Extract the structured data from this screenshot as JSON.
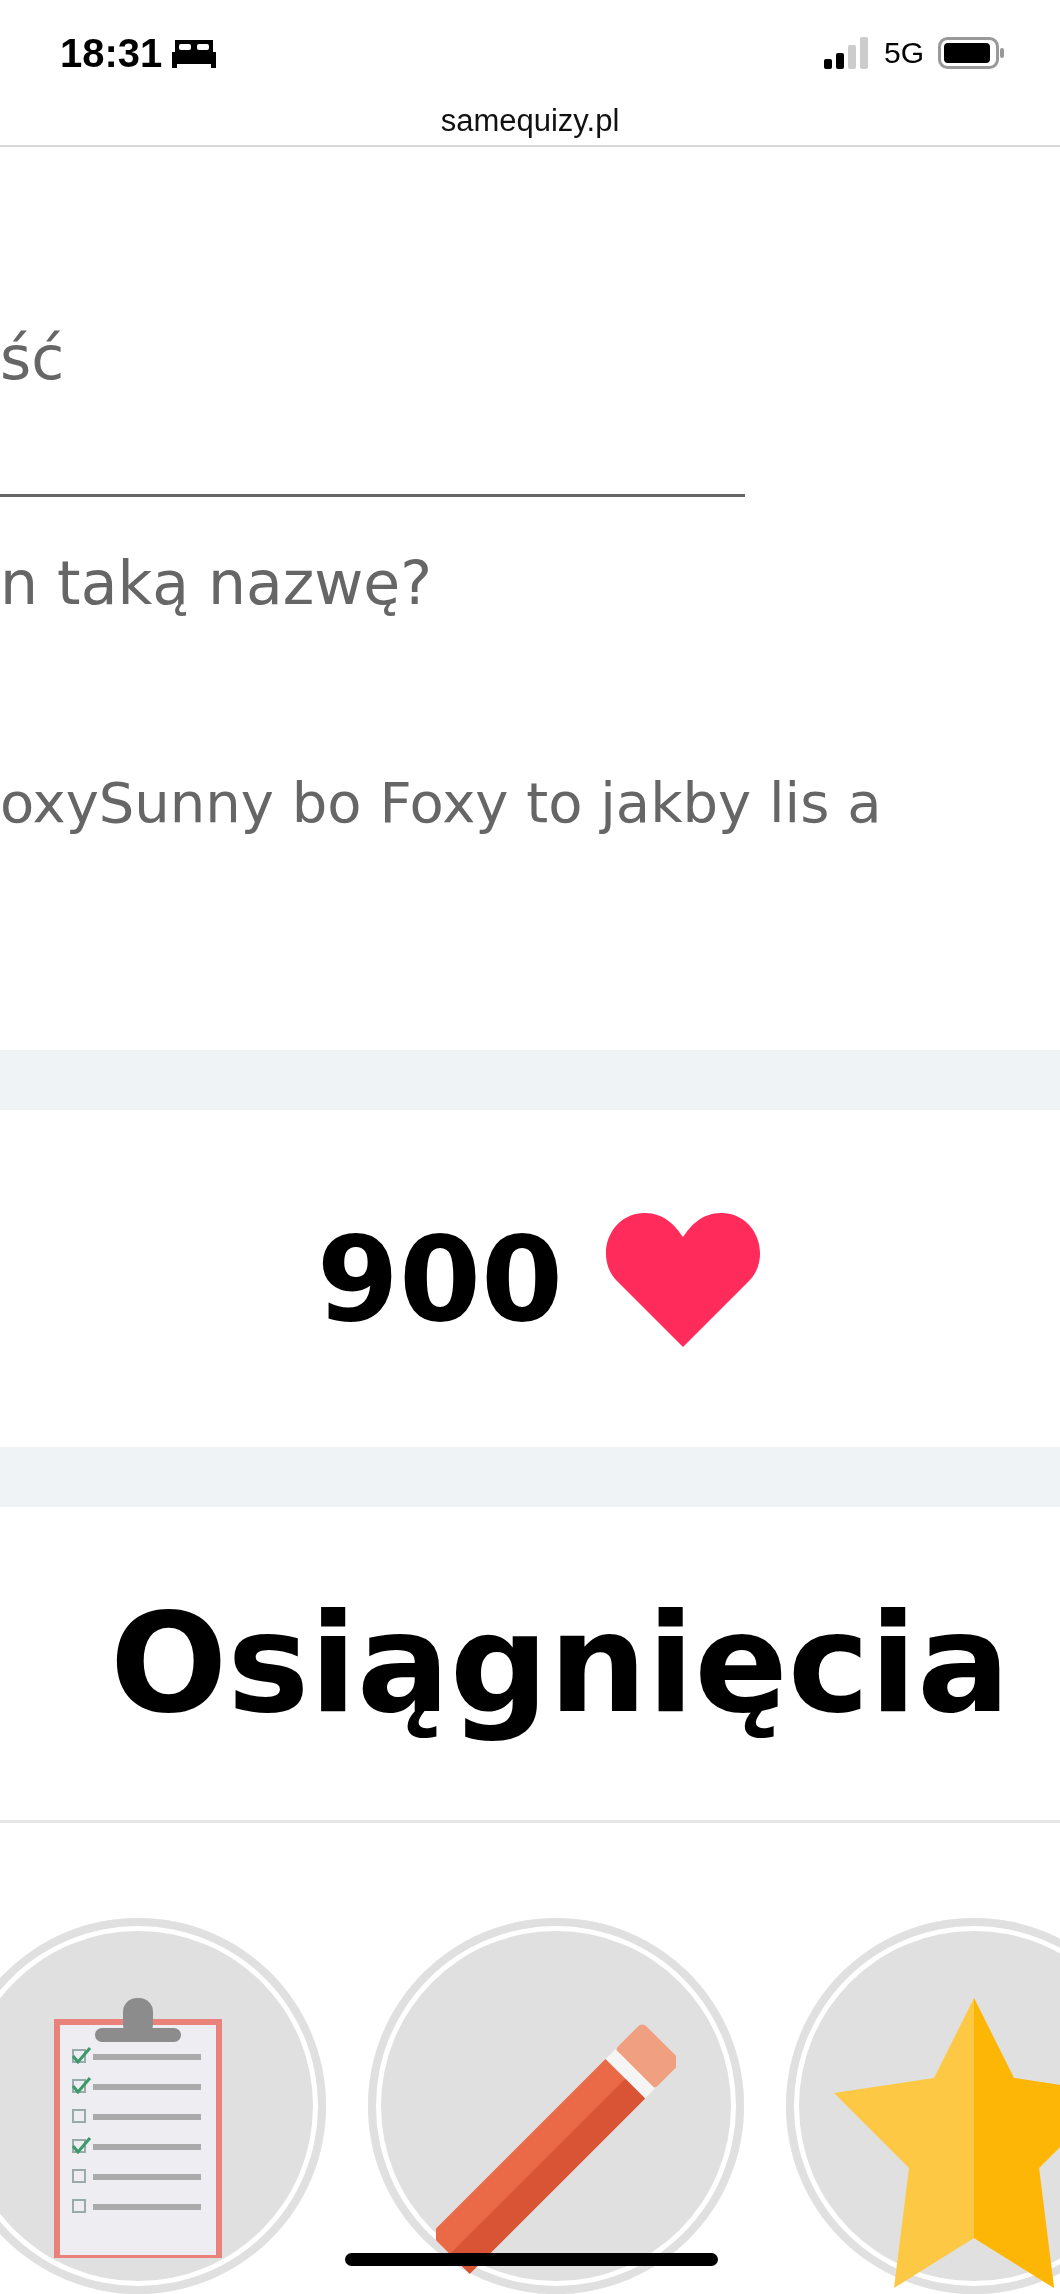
{
  "status_bar": {
    "time": "18:31",
    "network": "5G"
  },
  "address_bar": {
    "url": "samequizy.pl"
  },
  "question_block": {
    "top_text": "ść",
    "question": "n taką nazwę?",
    "answer": "oxySunny bo Foxy to jakby lis a"
  },
  "likes": {
    "count": "900"
  },
  "achievements": {
    "title": "Osiągnięcia",
    "badges": [
      {
        "kind": "clipboard"
      },
      {
        "kind": "pencil"
      },
      {
        "kind": "star"
      }
    ]
  }
}
